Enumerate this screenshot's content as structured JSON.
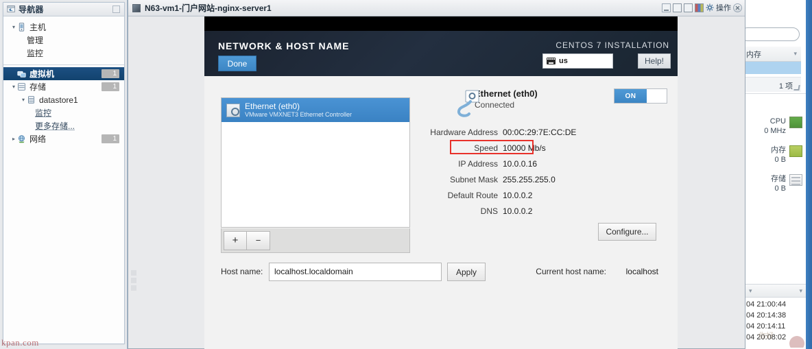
{
  "navigator": {
    "title": "导航器",
    "icon": "navigator-icon",
    "groups": [
      {
        "items": [
          {
            "label": "主机",
            "icon": "host-icon",
            "twisty": "▾",
            "level": 0,
            "badge": ""
          },
          {
            "label": "管理",
            "icon": "",
            "twisty": "",
            "level": 1,
            "badge": ""
          },
          {
            "label": "监控",
            "icon": "",
            "twisty": "",
            "level": 1,
            "badge": ""
          }
        ]
      },
      {
        "items": [
          {
            "label": "虚拟机",
            "icon": "vm-icon",
            "twisty": "",
            "level": 0,
            "badge": "1",
            "selected": true
          },
          {
            "label": "存储",
            "icon": "storage-icon",
            "twisty": "▾",
            "level": 0,
            "badge": "1"
          },
          {
            "label": "datastore1",
            "icon": "datastore-icon",
            "twisty": "▾",
            "level": 1,
            "badge": ""
          },
          {
            "label": "监控",
            "icon": "",
            "twisty": "",
            "level": 2,
            "badge": "",
            "link": true
          },
          {
            "label": "更多存储...",
            "icon": "",
            "twisty": "",
            "level": 2,
            "badge": "",
            "link": true
          },
          {
            "label": "网络",
            "icon": "network-icon",
            "twisty": "▸",
            "level": 0,
            "badge": "1"
          }
        ]
      }
    ]
  },
  "console_window": {
    "title": "N63-vm1-门户网站-nginx-server1",
    "title_icon": "vm-console-icon",
    "toolbar": {
      "minimize_icon": "minimize-icon",
      "restore_icon": "restore-icon",
      "maximize_icon": "maximize-icon",
      "screenshot_icon": "screenshot-icon",
      "gear_icon": "gear-icon",
      "actions_label": "操作",
      "close_icon": "close-icon"
    }
  },
  "installer": {
    "screen_title": "NETWORK & HOST NAME",
    "done_label": "Done",
    "brand": "CENTOS 7 INSTALLATION",
    "keyboard": {
      "icon": "keyboard-icon",
      "layout": "us"
    },
    "help_label": "Help!",
    "device_list": [
      {
        "name": "Ethernet (eth0)",
        "description": "VMware VMXNET3 Ethernet Controller",
        "icon": "ethernet-icon",
        "selected": true
      }
    ],
    "list_toolbar": {
      "add_label": "+",
      "remove_label": "−"
    },
    "detail": {
      "icon": "network-plug-icon",
      "name": "Ethernet (eth0)",
      "status": "Connected",
      "toggle_on_label": "ON",
      "toggle_state": "on",
      "fields": [
        {
          "label": "Hardware Address",
          "value": "00:0C:29:7E:CC:DE",
          "highlighted": false
        },
        {
          "label": "Speed",
          "value": "10000 Mb/s",
          "highlighted": true
        },
        {
          "label": "IP Address",
          "value": "10.0.0.16",
          "highlighted": false
        },
        {
          "label": "Subnet Mask",
          "value": "255.255.255.0",
          "highlighted": false
        },
        {
          "label": "Default Route",
          "value": "10.0.0.2",
          "highlighted": false
        },
        {
          "label": "DNS",
          "value": "10.0.0.2",
          "highlighted": false
        }
      ]
    },
    "configure_label": "Configure...",
    "host_name_label": "Host name:",
    "host_name_value": "localhost.localdomain",
    "host_name_placeholder": "localhost.localdomain",
    "apply_label": "Apply",
    "current_host_name_label": "Current host name:",
    "current_host_name_value": "localhost",
    "colors": {
      "accent_blue": "#3c86c4",
      "header_dark": "#1b2330",
      "highlight_red": "#e8312a"
    }
  },
  "background_panel": {
    "column_header": "内存",
    "item_count": "1 项",
    "metrics": [
      {
        "label": "CPU",
        "value": "0 MHz",
        "swatch": "cpu-meter-icon"
      },
      {
        "label": "内存",
        "value": "0 B",
        "swatch": "memory-meter-icon"
      },
      {
        "label": "存储",
        "value": "0 B",
        "swatch": "storage-meter-icon"
      }
    ],
    "log_lines": [
      "04 21:00:44",
      "04 20:14:38",
      "04 20:14:11",
      "04 20:08:02"
    ]
  },
  "watermark": {
    "left": "kpan.com"
  }
}
